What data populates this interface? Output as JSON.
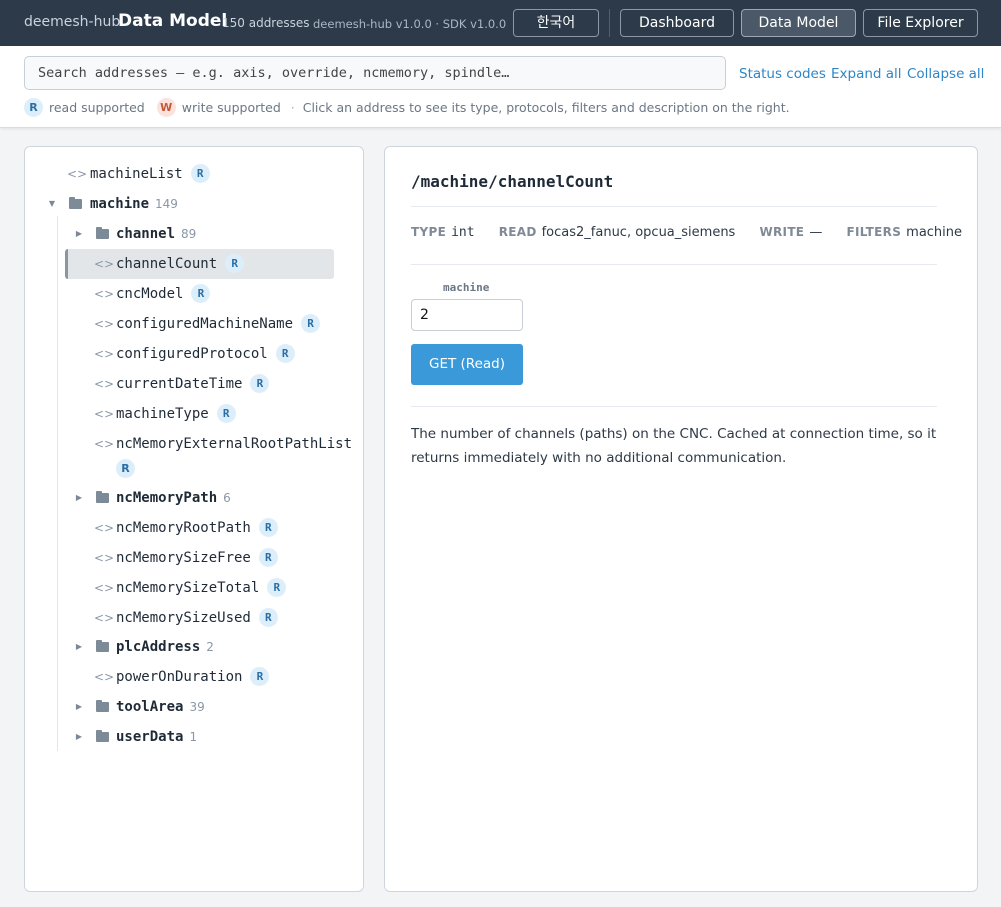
{
  "header": {
    "brand": "deemesh-hub",
    "title": "Data Model",
    "address_count": "150 addresses",
    "version": "deemesh-hub v1.0.0 · SDK v1.0.0",
    "language_button": "한국어",
    "nav": [
      {
        "label": "Dashboard",
        "active": false
      },
      {
        "label": "Data Model",
        "active": true
      },
      {
        "label": "File Explorer",
        "active": false
      }
    ]
  },
  "toolbar": {
    "search_placeholder": "Search addresses — e.g. axis, override, ncmemory, spindle…",
    "status_codes": "Status codes",
    "expand_all": "Expand all",
    "collapse_all": "Collapse all",
    "legend": {
      "read_badge": "R",
      "read_text": "read supported",
      "write_badge": "W",
      "write_text": "write supported",
      "separator": "·",
      "hint": "Click an address to see its type, protocols, filters and description on the right."
    }
  },
  "tree": {
    "items": [
      {
        "label": "machineList",
        "kind": "leaf",
        "badge": "R"
      },
      {
        "label": "machine",
        "kind": "folder",
        "count": "149",
        "expanded": true
      },
      {
        "label": "channel",
        "kind": "folder",
        "count": "89",
        "expanded": false
      },
      {
        "label": "channelCount",
        "kind": "leaf",
        "badge": "R",
        "selected": true
      },
      {
        "label": "cncModel",
        "kind": "leaf",
        "badge": "R"
      },
      {
        "label": "configuredMachineName",
        "kind": "leaf",
        "badge": "R"
      },
      {
        "label": "configuredProtocol",
        "kind": "leaf",
        "badge": "R"
      },
      {
        "label": "currentDateTime",
        "kind": "leaf",
        "badge": "R"
      },
      {
        "label": "machineType",
        "kind": "leaf",
        "badge": "R"
      },
      {
        "label": "ncMemoryExternalRootPathList",
        "kind": "leaf",
        "badge": "R"
      },
      {
        "label": "ncMemoryPath",
        "kind": "folder",
        "count": "6",
        "expanded": false
      },
      {
        "label": "ncMemoryRootPath",
        "kind": "leaf",
        "badge": "R"
      },
      {
        "label": "ncMemorySizeFree",
        "kind": "leaf",
        "badge": "R"
      },
      {
        "label": "ncMemorySizeTotal",
        "kind": "leaf",
        "badge": "R"
      },
      {
        "label": "ncMemorySizeUsed",
        "kind": "leaf",
        "badge": "R"
      },
      {
        "label": "plcAddress",
        "kind": "folder",
        "count": "2",
        "expanded": false
      },
      {
        "label": "powerOnDuration",
        "kind": "leaf",
        "badge": "R"
      },
      {
        "label": "toolArea",
        "kind": "folder",
        "count": "39",
        "expanded": false
      },
      {
        "label": "userData",
        "kind": "folder",
        "count": "1",
        "expanded": false
      }
    ]
  },
  "detail": {
    "path": "/machine/channelCount",
    "type_key": "TYPE",
    "type_value": "int",
    "read_key": "READ",
    "read_value": "focas2_fanuc, opcua_siemens",
    "write_key": "WRITE",
    "write_value": "—",
    "filters_key": "FILTERS",
    "filters_value": "machine",
    "param_label": "machine",
    "param_value": "2",
    "get_button": "GET (Read)",
    "description": "The number of channels (paths) on the CNC. Cached at connection time, so it returns immediately with no additional communication."
  }
}
